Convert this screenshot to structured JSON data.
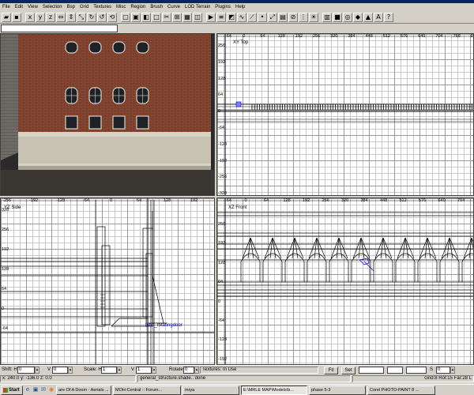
{
  "menu": [
    "File",
    "Edit",
    "View",
    "Selection",
    "Bsp",
    "Grid",
    "Textures",
    "Misc",
    "Region",
    "Brush",
    "Curve",
    "LOD Terrain",
    "Plugins",
    "Help"
  ],
  "toolbar_icons": [
    "open-icon",
    "save-icon",
    "x-axis-icon",
    "y-axis-icon",
    "z-axis-icon",
    "flip-x-icon",
    "flip-y-icon",
    "flip-z-icon",
    "rotate-x-icon",
    "rotate-y-icon",
    "rotate-z-icon",
    "select-icon",
    "csg-subtract-icon",
    "csg-merge-icon",
    "hollow-icon",
    "clipper-icon",
    "change-view-icon",
    "texture-view-icon",
    "cubic-clip-icon",
    "camera-movement-icon",
    "entity-list-icon",
    "show-patches-icon",
    "curve-icon",
    "drag-edge-icon",
    "drag-vertex-icon",
    "scale-icon",
    "patch-icon",
    "invert-curve-icon",
    "redisperse-icon",
    "light-icon",
    "patch-tess-icon",
    "brush-icon",
    "camera-icon",
    "lod-icon",
    "terrain-icon",
    "a-icon",
    "help-icon"
  ],
  "texture_input": "",
  "views": {
    "xy": {
      "name": "XY Top",
      "h_ticks": [
        "-64",
        "0",
        "64",
        "128",
        "192",
        "256",
        "320",
        "384",
        "448",
        "512",
        "576",
        "640",
        "704",
        "768",
        "832",
        "896"
      ],
      "v_ticks": [
        "256",
        "192",
        "128",
        "64",
        "0",
        "-64",
        "-128",
        "-192",
        "-256",
        "-320"
      ]
    },
    "yz": {
      "name": "YZ Side",
      "h_ticks": [
        "-256",
        "-192",
        "-128",
        "-64",
        "0",
        "64",
        "128",
        "192"
      ],
      "v_ticks": [
        "320",
        "256",
        "192",
        "128",
        "64",
        "0",
        "-64"
      ]
    },
    "xz": {
      "name": "XZ Front",
      "h_ticks": [
        "-64",
        "0",
        "64",
        "128",
        "192",
        "256",
        "320",
        "384",
        "448",
        "512",
        "576",
        "640",
        "704",
        "768"
      ],
      "v_ticks": [
        "256",
        "192",
        "128",
        "64",
        "0",
        "-64",
        "-128",
        "-192"
      ]
    },
    "yz_entity": "func_rotatingdoor"
  },
  "status": {
    "shift_h_label": "Shift: H",
    "shift_h_value": "0",
    "shift_v_label": "V",
    "shift_v_value": "0",
    "scale_h_label": "Scale: H",
    "scale_h_value": "1",
    "scale_v_label": "V",
    "scale_v_value": "1",
    "rotate_label": "Rotate",
    "rotate_value": "0",
    "textures_in_use": "Textures: In Use",
    "fit_label": "Fit",
    "set_label": "Set",
    "s_label": "S",
    "s_value": "0",
    "coords": "x:  240.0   y:  -136.0  z:  0.0",
    "shader_msg": "general_structure.shade.. done",
    "grid_info": "Grid:8  Rot:15  Far:28  L"
  },
  "taskbar": {
    "start": "Start",
    "tasks": [
      "are Of A Doom - Aerials ...",
      "MOH-Central :: Forum...",
      "mrya",
      "E:\\MRLE MAP\\Models\\b...",
      "phase 5-3",
      "Corel PHOTO-PAINT 8 ..."
    ]
  }
}
